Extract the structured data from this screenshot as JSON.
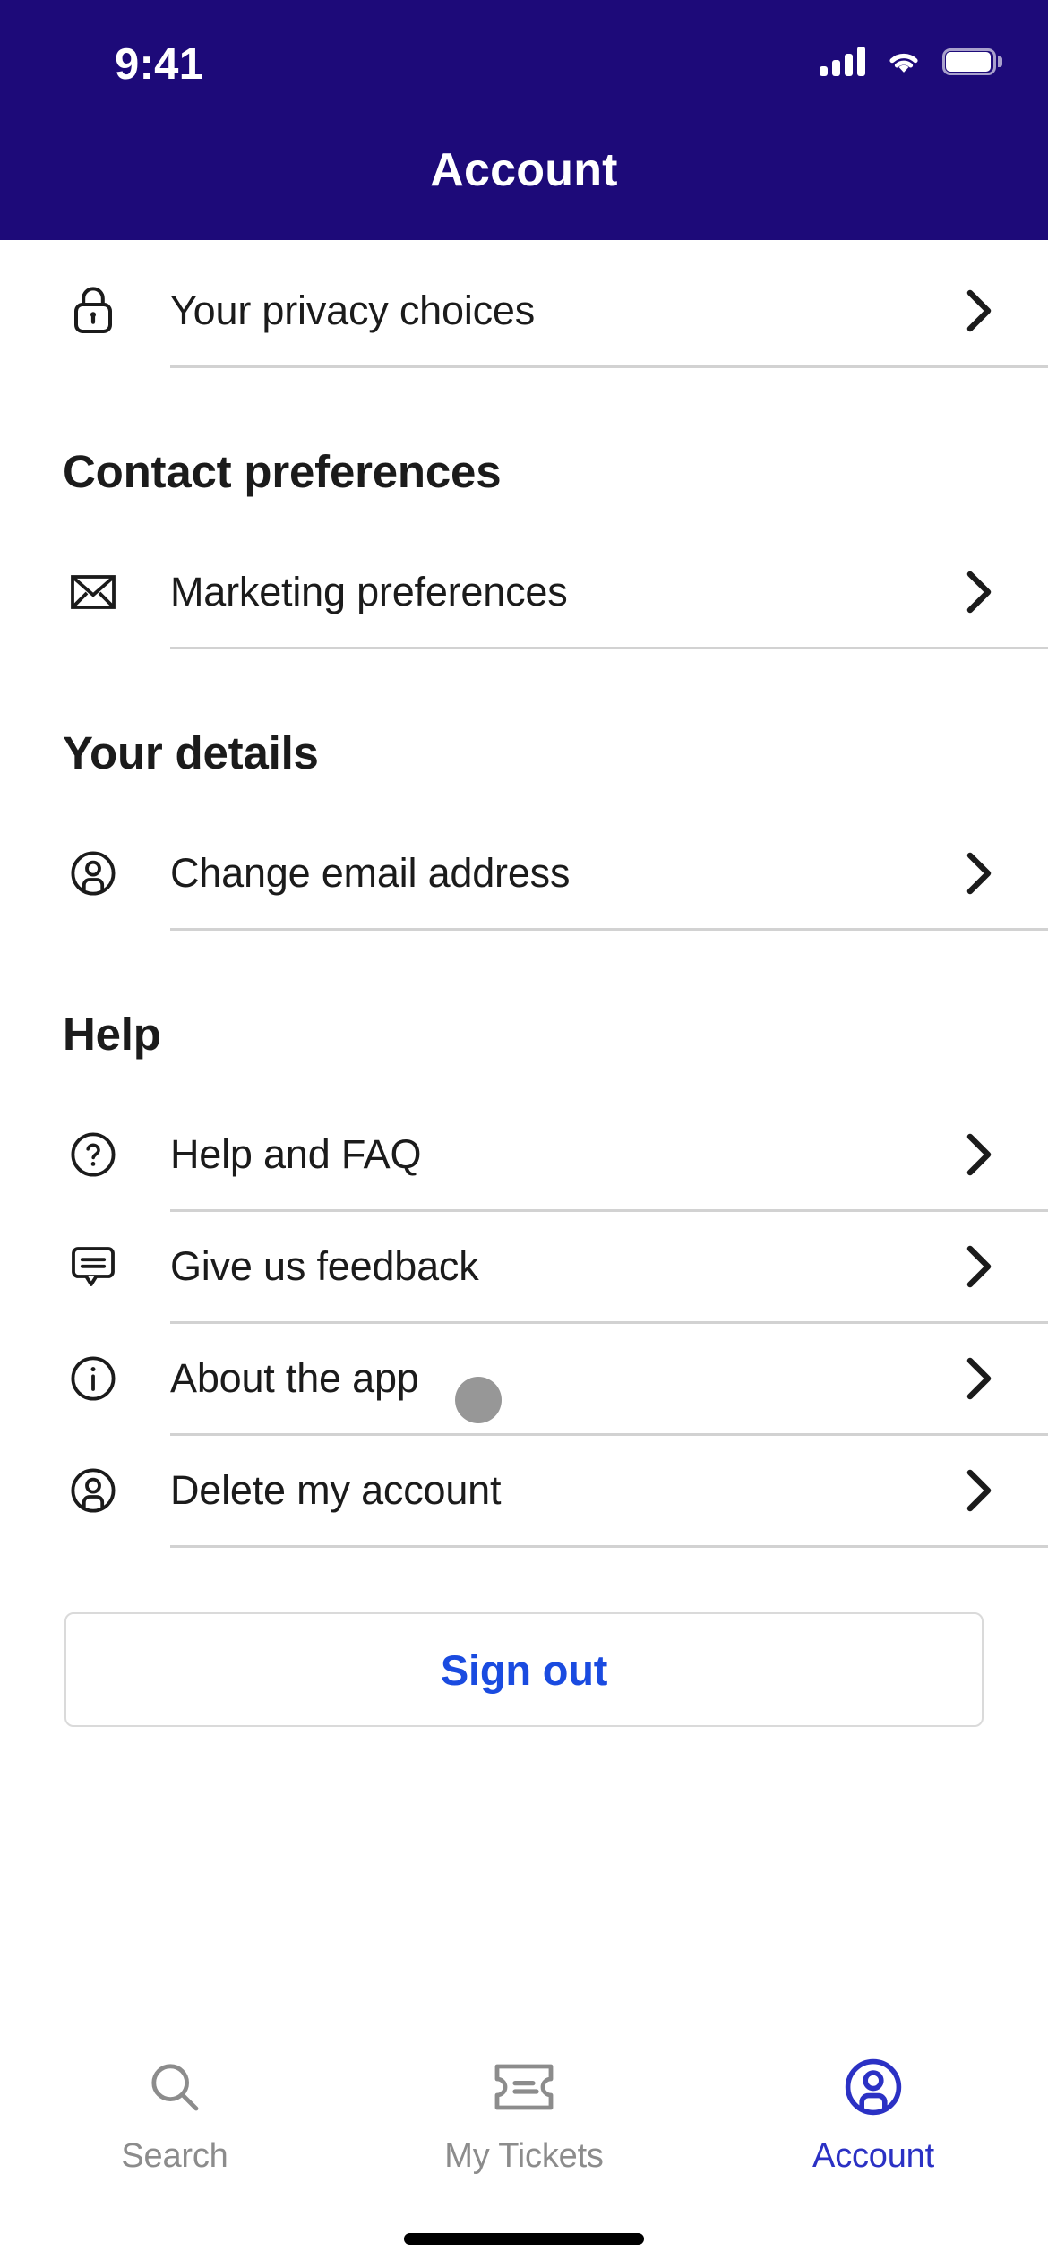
{
  "status_bar": {
    "time": "9:41",
    "cellular_icon": "cellular-signal-icon",
    "wifi_icon": "wifi-icon",
    "battery_icon": "battery-icon"
  },
  "header": {
    "title": "Account",
    "background_color": "#1D0A79",
    "text_color": "#FFFFFF"
  },
  "sections": [
    {
      "title": "",
      "items": [
        {
          "label": "Your privacy choices",
          "icon": "lock-icon"
        }
      ]
    },
    {
      "title": "Contact preferences",
      "items": [
        {
          "label": "Marketing preferences",
          "icon": "envelope-icon"
        }
      ]
    },
    {
      "title": "Your details",
      "items": [
        {
          "label": "Change email address",
          "icon": "person-circle-icon"
        }
      ]
    },
    {
      "title": "Help",
      "items": [
        {
          "label": "Help and FAQ",
          "icon": "question-circle-icon"
        },
        {
          "label": "Give us feedback",
          "icon": "speech-bubble-icon"
        },
        {
          "label": "About the app",
          "icon": "info-circle-icon"
        },
        {
          "label": "Delete my account",
          "icon": "person-circle-icon"
        }
      ]
    }
  ],
  "sign_out": {
    "label": "Sign out",
    "text_color": "#1A4BE0"
  },
  "tabbar": {
    "items": [
      {
        "label": "Search",
        "icon": "search-icon",
        "active": false
      },
      {
        "label": "My Tickets",
        "icon": "ticket-icon",
        "active": false
      },
      {
        "label": "Account",
        "icon": "person-circle-icon",
        "active": true
      }
    ],
    "active_color": "#2B31C4",
    "inactive_color": "#8C8C8C"
  },
  "tap_indicator": {
    "color": "#979797"
  }
}
